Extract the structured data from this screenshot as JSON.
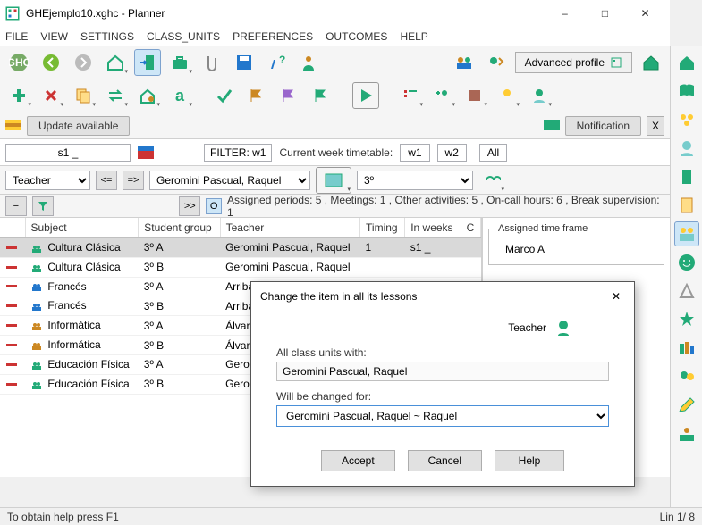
{
  "window": {
    "title": "GHEjemplo10.xghc - Planner"
  },
  "menu": {
    "file": "FILE",
    "view": "VIEW",
    "settings": "SETTINGS",
    "class_units": "CLASS_UNITS",
    "preferences": "PREFERENCES",
    "outcomes": "OUTCOMES",
    "help": "HELP"
  },
  "toolbar": {
    "advanced_profile": "Advanced profile"
  },
  "notify": {
    "update": "Update available",
    "notification": "Notification",
    "close_x": "X"
  },
  "filter": {
    "s1": "s1 _",
    "label": "FILTER: w1",
    "cur": "Current week timetable:",
    "w1": "w1",
    "w2": "w2",
    "all": "All"
  },
  "selrow": {
    "teacher": "Teacher",
    "name": "Geromini Pascual, Raquel",
    "third": "3º"
  },
  "status": {
    "zoom": ">>",
    "assigned": "Assigned periods:  5 , Meetings: 1 , Other activities:   5 , On-call hours: 6 , Break supervision: 1"
  },
  "grid": {
    "cols": {
      "subject": "Subject",
      "group": "Student group",
      "teacher": "Teacher",
      "timing": "Timing",
      "inweeks": "In weeks",
      "c": "C"
    },
    "rows": [
      {
        "subject": "Cultura Clásica",
        "group": "3º A",
        "teacher": "Geromini Pascual, Raquel",
        "timing": "1",
        "inweeks": "s1 _",
        "c": ""
      },
      {
        "subject": "Cultura Clásica",
        "group": "3º B",
        "teacher": "Geromini Pascual, Raquel",
        "timing": "",
        "inweeks": "",
        "c": ""
      },
      {
        "subject": "Francés",
        "group": "3º A",
        "teacher": "Arribas T",
        "timing": "",
        "inweeks": "",
        "c": ""
      },
      {
        "subject": "Francés",
        "group": "3º B",
        "teacher": "Arribas T",
        "timing": "",
        "inweeks": "",
        "c": ""
      },
      {
        "subject": "Informática",
        "group": "3º A",
        "teacher": "Álvarez E",
        "timing": "",
        "inweeks": "",
        "c": ""
      },
      {
        "subject": "Informática",
        "group": "3º B",
        "teacher": "Álvarez E",
        "timing": "",
        "inweeks": "",
        "c": ""
      },
      {
        "subject": "Educación Física",
        "group": "3º A",
        "teacher": "Geromi",
        "timing": "",
        "inweeks": "",
        "c": ""
      },
      {
        "subject": "Educación Física",
        "group": "3º B",
        "teacher": "Geromi",
        "timing": "",
        "inweeks": "",
        "c": ""
      }
    ]
  },
  "side": {
    "legend": "Assigned time frame",
    "marco": "Marco A"
  },
  "dialog": {
    "title": "Change the item in all its lessons",
    "teacher": "Teacher",
    "all_with": "All class units with:",
    "current": "Geromini Pascual, Raquel",
    "changed_for": "Will be changed for:",
    "new_value": "Geromini Pascual, Raquel ~ Raquel",
    "accept": "Accept",
    "cancel": "Cancel",
    "help": "Help"
  },
  "statusbar": {
    "help": "To obtain help press F1",
    "lin": "Lin 1/ 8"
  }
}
